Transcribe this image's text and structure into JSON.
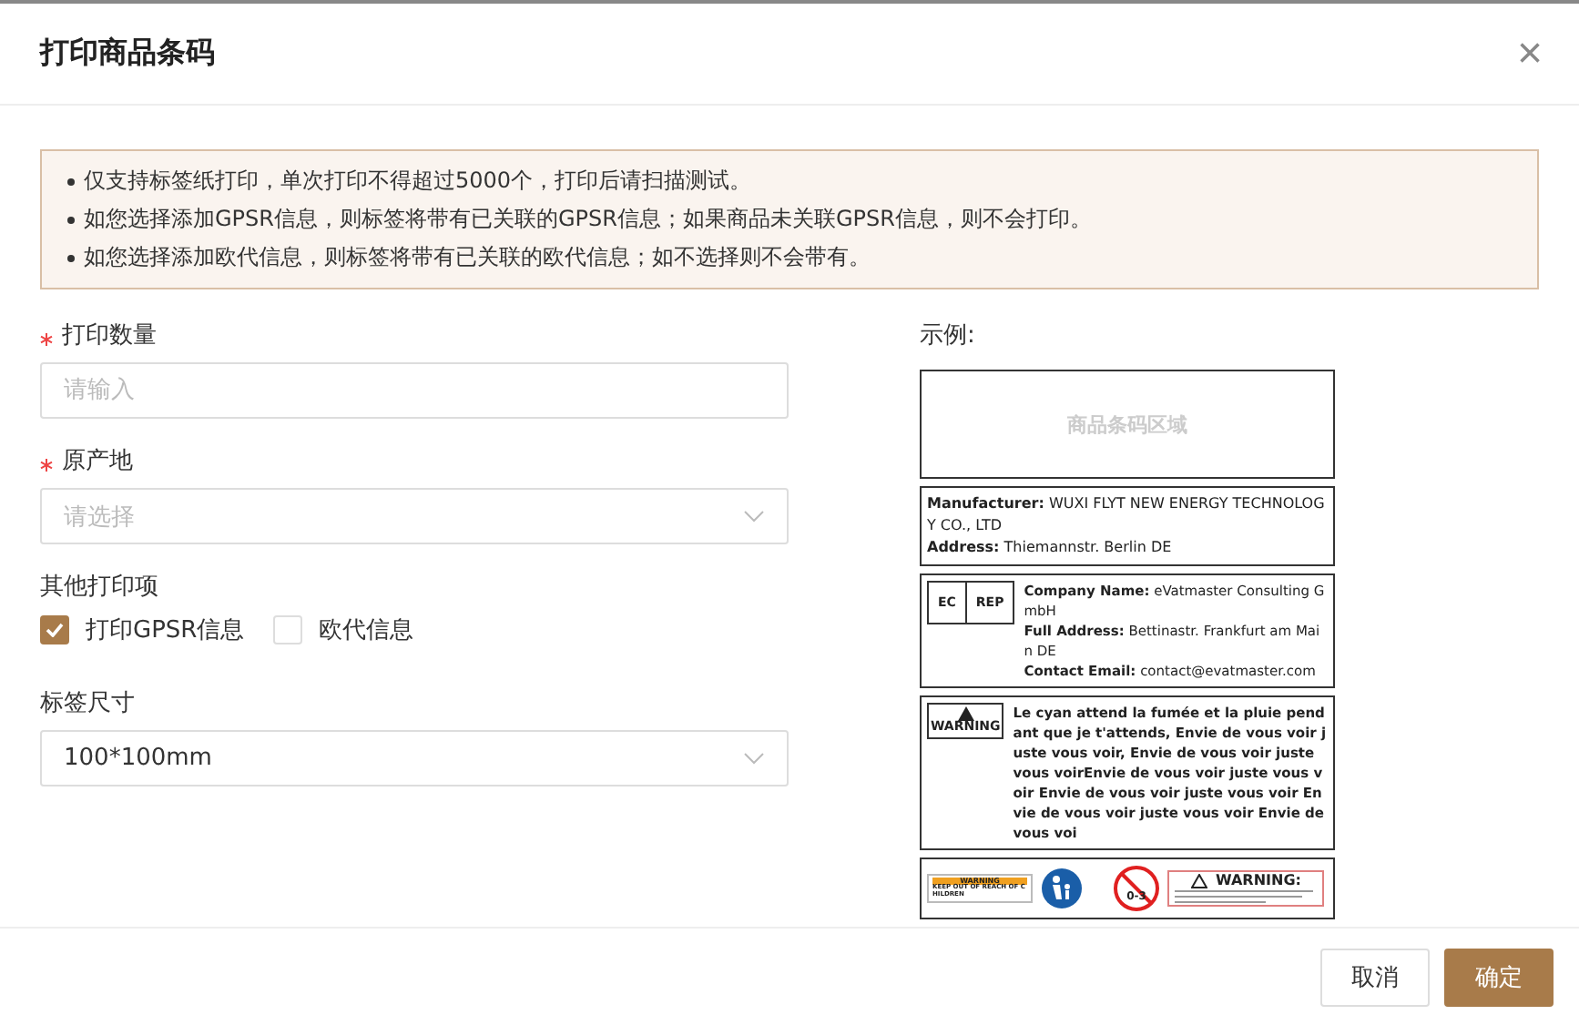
{
  "dialog": {
    "title": "打印商品条码",
    "close": "×"
  },
  "notices": [
    "仅支持标签纸打印，单次打印不得超过5000个，打印后请扫描测试。",
    "如您选择添加GPSR信息，则标签将带有已关联的GPSR信息；如果商品未关联GPSR信息，则不会打印。",
    "如您选择添加欧代信息，则标签将带有已关联的欧代信息；如不选择则不会带有。"
  ],
  "form": [
    {
      "kind": "input",
      "label": "打印数量",
      "required": true,
      "placeholder": "请输入"
    },
    {
      "kind": "select",
      "label": "原产地",
      "required": true,
      "placeholder": "请选择"
    },
    {
      "kind": "checks",
      "label": "其他打印项",
      "options": [
        {
          "label": "打印GPSR信息",
          "checked": true
        },
        {
          "label": "欧代信息",
          "checked": false
        }
      ]
    },
    {
      "kind": "select",
      "label": "标签尺寸",
      "required": false,
      "value": "100*100mm"
    }
  ],
  "sample": {
    "title": "示例:",
    "barcode_area": "商品条码区域",
    "manufacturer": [
      {
        "key": "Manufacturer:",
        "value": "WUXI FLYT NEW ENERGY TECHNOLOGY CO., LTD"
      },
      {
        "key": "Address:",
        "value": "Thiemannstr. Berlin DE"
      }
    ],
    "ec_rep": {
      "badges": [
        "EC",
        "REP"
      ],
      "lines": [
        {
          "key": "Company Name:",
          "value": "eVatmaster Consulting GmbH"
        },
        {
          "key": "Full Address:",
          "value": "Bettinastr. Frankfurt am Main DE"
        },
        {
          "key": "Contact Email:",
          "value": "contact@evatmaster.com"
        }
      ]
    },
    "warning": {
      "badge": "WARNING",
      "text": "Le cyan attend la fumée et la pluie pendant que je t'attends, Envie de vous voir juste vous voir, Envie de vous voir juste vous voirEnvie de vous voir juste vous voir Envie de vous voir juste vous voir Envie de vous voir juste vous voir Envie de vous voi"
    },
    "symbols": {
      "warning_left": "WARNING",
      "keep_out": "KEEP OUT OF REACH OF CHILDREN",
      "age": "0-3",
      "warning_right": "WARNING:"
    }
  },
  "buttons": [
    {
      "label": "取消",
      "primary": false
    },
    {
      "label": "确定",
      "primary": true
    }
  ]
}
